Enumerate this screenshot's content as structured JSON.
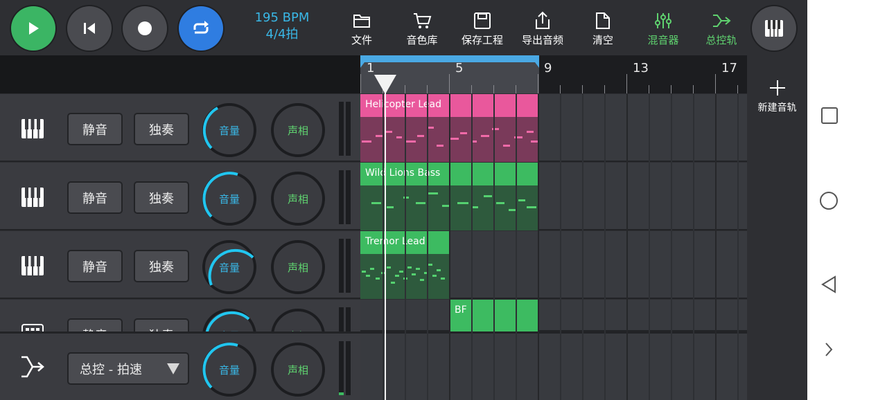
{
  "transport": {
    "bpm": "195 BPM",
    "time_signature": "4/4拍"
  },
  "toolbar": {
    "file": "文件",
    "sound_library": "音色库",
    "save_project": "保存工程",
    "export_audio": "导出音频",
    "clear": "清空",
    "mixer": "混音器",
    "master_track": "总控轨"
  },
  "ruler": {
    "markers": [
      "1",
      "5",
      "9",
      "13",
      "17"
    ]
  },
  "tracks": [
    {
      "mute": "静音",
      "solo": "独奏",
      "volume": "音量",
      "pan": "声相",
      "clip": "Helicopter Lead",
      "color": "#e9589c"
    },
    {
      "mute": "静音",
      "solo": "独奏",
      "volume": "音量",
      "pan": "声相",
      "clip": "Wild Lions Bass",
      "color": "#3dbb61"
    },
    {
      "mute": "静音",
      "solo": "独奏",
      "volume": "音量",
      "pan": "声相",
      "clip": "Tremor Lead",
      "color": "#3dbb61"
    },
    {
      "mute": "静音",
      "solo": "独奏",
      "volume": "音量",
      "pan": "声相",
      "clip": "BF",
      "color": "#3dbb61"
    }
  ],
  "master": {
    "selector": "总控 - 拍速",
    "volume": "音量",
    "pan": "声相"
  },
  "side": {
    "new_track": "新建音轨"
  },
  "colors": {
    "accent_blue": "#39b7e6",
    "accent_green": "#5fd26f",
    "pink": "#e9589c"
  }
}
